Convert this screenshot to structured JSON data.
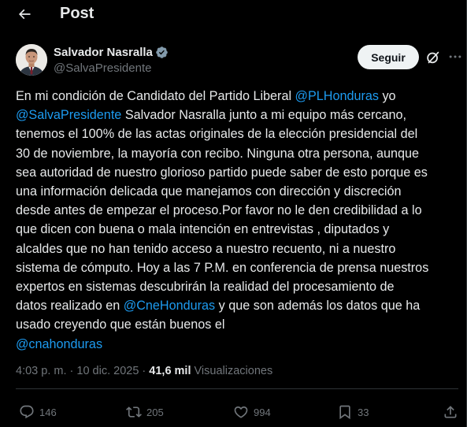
{
  "header": {
    "title": "Post"
  },
  "author": {
    "name": "Salvador Nasralla",
    "handle": "@SalvaPresidente"
  },
  "follow_button": {
    "label": "Seguir"
  },
  "tweet": {
    "lines": [
      [
        {
          "t": "En mi condición de Candidato del Partido Liberal "
        },
        {
          "t": "@PLHonduras",
          "m": true
        },
        {
          "t": " yo"
        }
      ],
      [
        {
          "t": "@SalvaPresidente",
          "m": true
        },
        {
          "t": " Salvador Nasralla junto a mi equipo más cercano,"
        }
      ],
      [
        {
          "t": "tenemos el 100% de las actas originales de la elección presidencial del"
        }
      ],
      [
        {
          "t": "30 de noviembre, la mayoría con recibo. Ninguna otra persona, aunque"
        }
      ],
      [
        {
          "t": "sea autoridad de nuestro glorioso partido puede saber de esto porque es"
        }
      ],
      [
        {
          "t": "una información delicada que manejamos con dirección y discreción"
        }
      ],
      [
        {
          "t": "desde antes de empezar el proceso.Por favor no le den credibilidad a lo"
        }
      ],
      [
        {
          "t": "que dicen con buena o mala intención en entrevistas , diputados y"
        }
      ],
      [
        {
          "t": "alcaldes que no han tenido acceso a nuestro recuento, ni a nuestro"
        }
      ],
      [
        {
          "t": "sistema de cómputo. Hoy a las 7 P.M. en conferencia de prensa nuestros"
        }
      ],
      [
        {
          "t": "expertos en sistemas descubrirán la realidad del procesamiento de"
        }
      ],
      [
        {
          "t": "datos realizado en "
        },
        {
          "t": "@CneHonduras",
          "m": true
        },
        {
          "t": " y que son además los datos que ha"
        }
      ],
      [
        {
          "t": "usado creyendo que están buenos el"
        }
      ],
      [
        {
          "t": "@cnahonduras",
          "m": true
        }
      ]
    ]
  },
  "meta": {
    "time": "4:03 p. m.",
    "separator": "·",
    "date": "10 dic. 2025",
    "views_count": "41,6 mil",
    "views_label": "Visualizaciones"
  },
  "actions": {
    "replies": "146",
    "reposts": "205",
    "likes": "994",
    "bookmarks": "33"
  },
  "colors": {
    "background": "#000000",
    "text": "#e7e9ea",
    "muted": "#71767b",
    "link": "#1d9bf0",
    "verified": "#829aab",
    "divider": "#2f3336"
  },
  "icons": [
    "back-arrow-icon",
    "verified-badge-icon",
    "grok-icon",
    "more-icon",
    "reply-icon",
    "repost-icon",
    "like-icon",
    "bookmark-icon",
    "share-icon"
  ]
}
